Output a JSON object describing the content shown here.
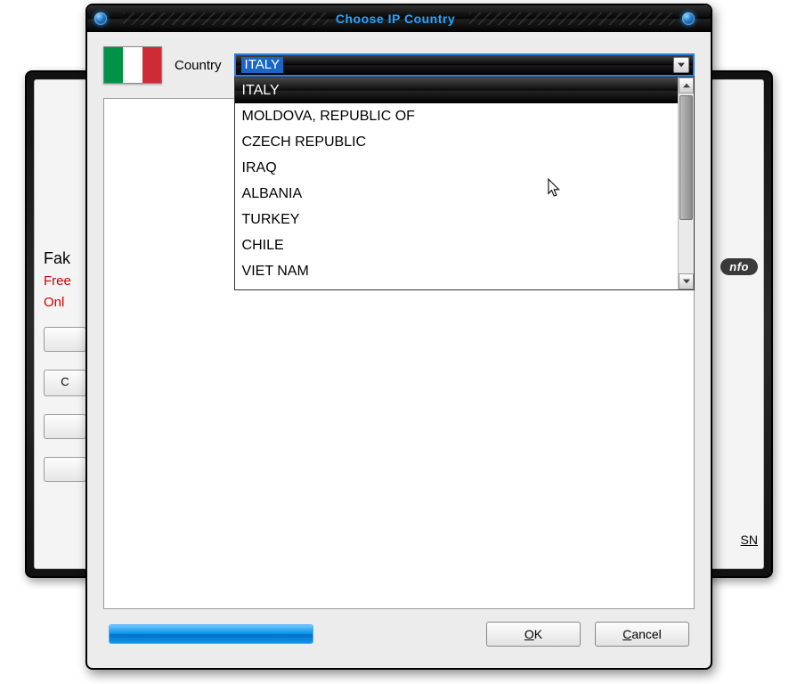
{
  "back_window": {
    "heading_fragment": "Fak",
    "redline1": "Free",
    "redline2": "Onl",
    "left_button1_fragment": "",
    "left_button2_fragment": "C",
    "info_pill_fragment": "nfo",
    "sn_fragment": "SN"
  },
  "dialog": {
    "title": "Choose IP Country",
    "country_label": "Country",
    "selected_value": "ITALY",
    "options": [
      "ITALY",
      "MOLDOVA, REPUBLIC OF",
      "CZECH REPUBLIC",
      "IRAQ",
      "ALBANIA",
      "TURKEY",
      "CHILE",
      "VIET NAM"
    ],
    "selected_index": 0,
    "ok_prefix": "O",
    "ok_rest": "K",
    "cancel_prefix": "C",
    "cancel_rest": "ancel",
    "flag_country": "italy"
  }
}
